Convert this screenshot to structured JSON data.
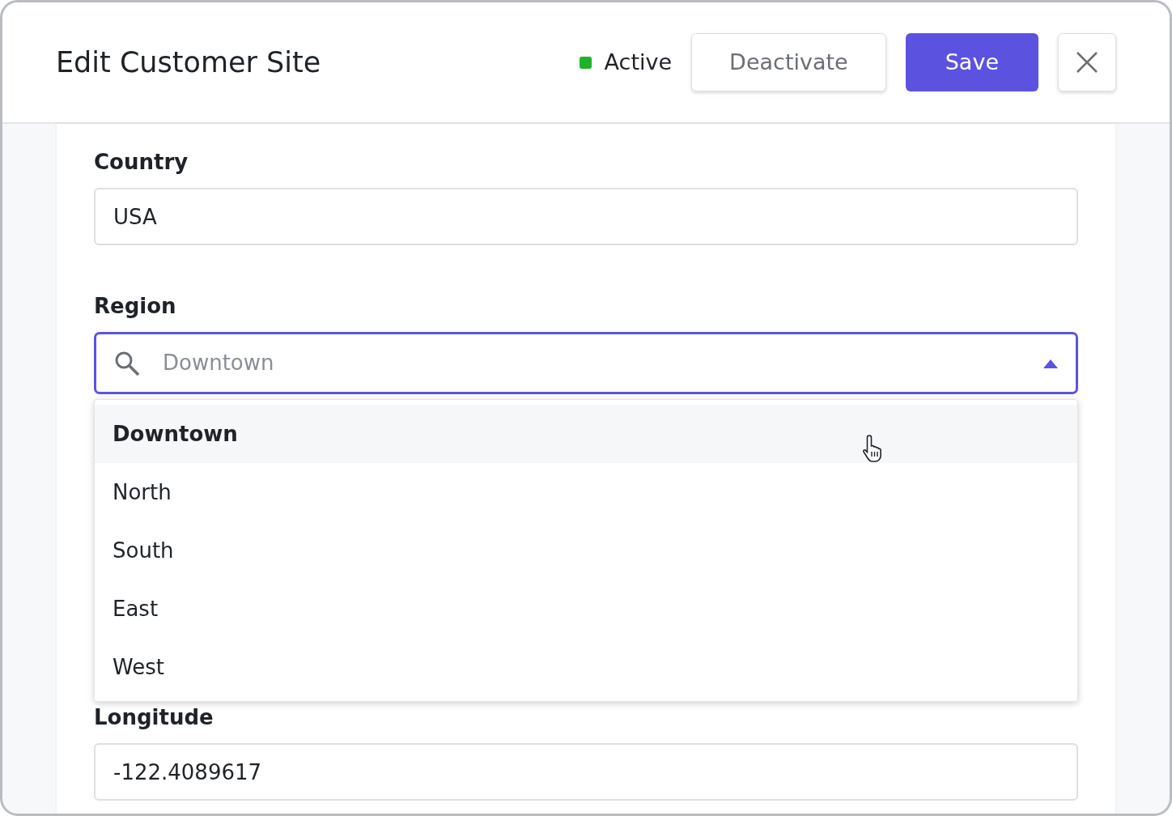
{
  "header": {
    "title": "Edit Customer Site",
    "status": {
      "label": "Active",
      "color": "#1db32a"
    },
    "buttons": [
      {
        "label": "Deactivate",
        "kind": "secondary"
      },
      {
        "label": "Save",
        "kind": "primary"
      }
    ]
  },
  "fields": [
    {
      "label": "Country",
      "kind": "text",
      "value": "USA"
    },
    {
      "label": "Region",
      "kind": "combobox",
      "placeholder": "Downtown",
      "expanded": true,
      "options": [
        {
          "label": "Downtown",
          "selected": true
        },
        {
          "label": "North",
          "selected": false
        },
        {
          "label": "South",
          "selected": false
        },
        {
          "label": "East",
          "selected": false
        },
        {
          "label": "West",
          "selected": false
        }
      ]
    },
    {
      "label": "Longitude",
      "kind": "text",
      "value": "-122.4089617"
    }
  ]
}
